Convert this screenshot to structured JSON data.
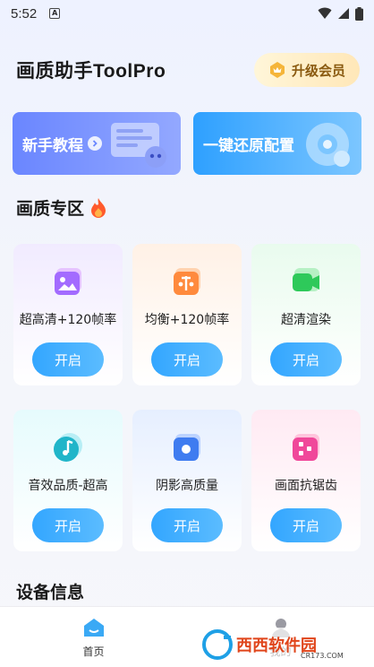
{
  "status_bar": {
    "time": "5:52",
    "notif_badge": "A"
  },
  "header": {
    "title": "画质助手ToolPro",
    "vip_label": "升级会员"
  },
  "banners": {
    "tutorial_label": "新手教程",
    "restore_label": "一键还原配置"
  },
  "sections": {
    "quality_title": "画质专区",
    "device_title": "设备信息"
  },
  "cards": [
    {
      "label": "超高清+120帧率",
      "button": "开启",
      "icon": "image-icon"
    },
    {
      "label": "均衡+120帧率",
      "button": "开启",
      "icon": "balance-icon"
    },
    {
      "label": "超清渲染",
      "button": "开启",
      "icon": "video-icon"
    },
    {
      "label": "音效品质-超高",
      "button": "开启",
      "icon": "music-note-icon"
    },
    {
      "label": "阴影高质量",
      "button": "开启",
      "icon": "shadow-icon"
    },
    {
      "label": "画面抗锯齿",
      "button": "开启",
      "icon": "pixel-grid-icon"
    }
  ],
  "bottom_nav": {
    "home_label": "首页",
    "mine_label": "我的"
  },
  "watermark": {
    "brand": "西西软件园",
    "url": "CR173.COM"
  },
  "colors": {
    "accent_blue": "#33a6ff",
    "banner_left": "#6a86ff",
    "banner_right": "#2ea0ff",
    "vip_gold": "#8a5a10"
  }
}
